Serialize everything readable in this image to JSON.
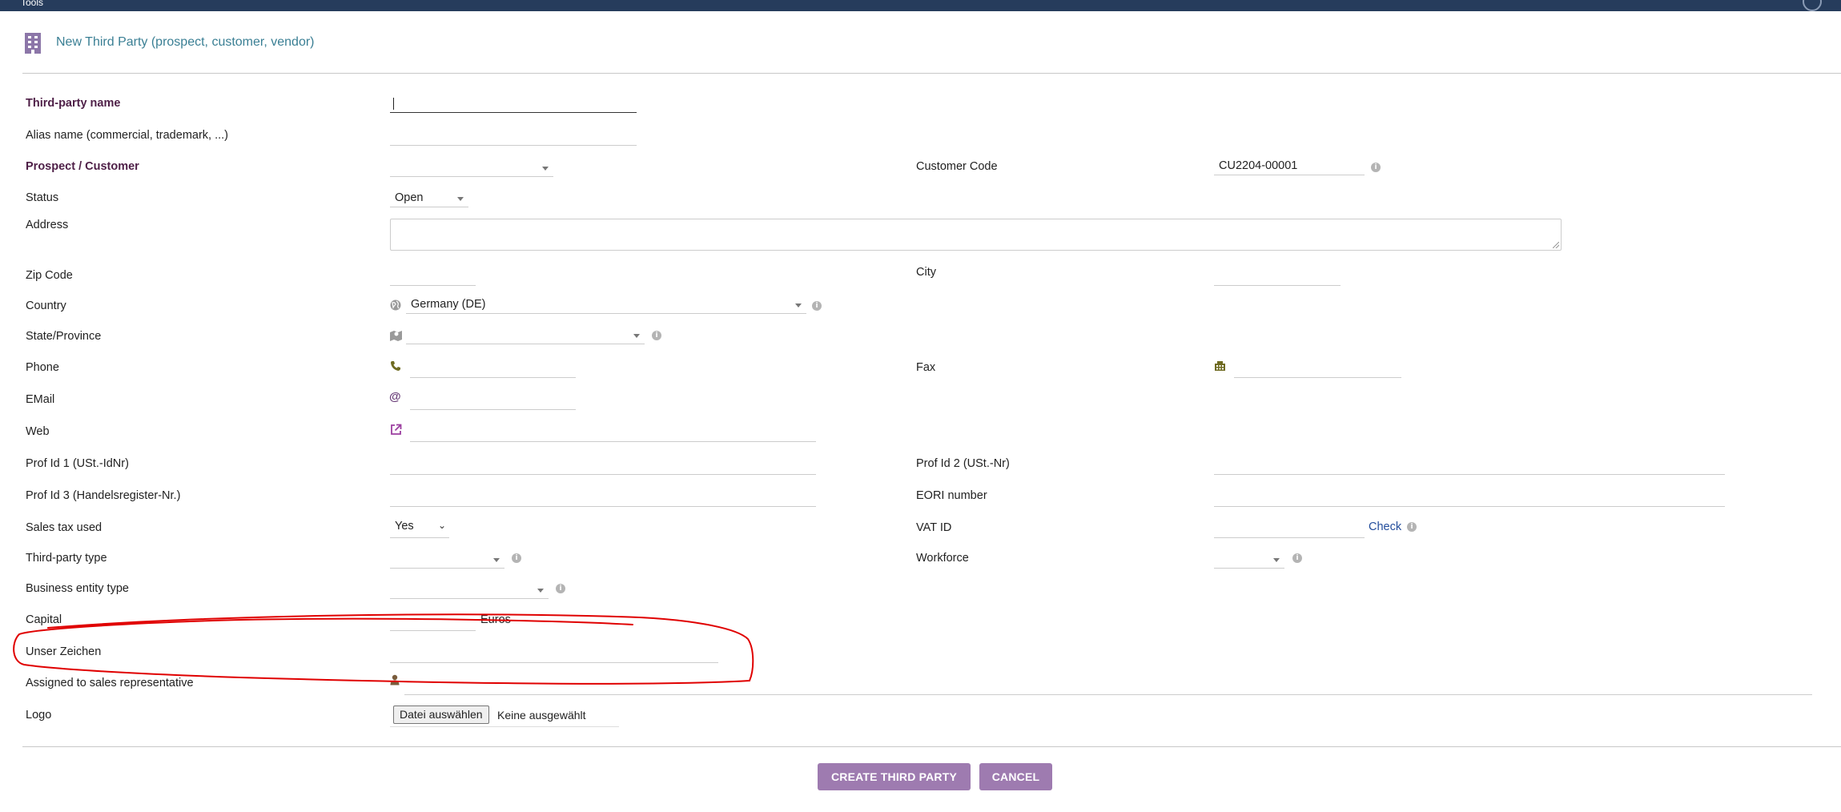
{
  "topbar": {
    "title": "Tools"
  },
  "header": {
    "title": "New Third Party (prospect, customer, vendor)",
    "icon": "building-icon",
    "icon_color": "#8c76a8"
  },
  "form": {
    "third_party_name": {
      "label": "Third-party name",
      "value": ""
    },
    "alias_name": {
      "label": "Alias name (commercial, trademark, ...)",
      "value": ""
    },
    "prospect_customer": {
      "label": "Prospect / Customer",
      "value": ""
    },
    "customer_code": {
      "label": "Customer Code",
      "value": "CU2204-00001"
    },
    "status": {
      "label": "Status",
      "value": "Open"
    },
    "address": {
      "label": "Address",
      "value": ""
    },
    "zip": {
      "label": "Zip Code",
      "value": ""
    },
    "city": {
      "label": "City",
      "value": ""
    },
    "country": {
      "label": "Country",
      "value": "Germany (DE)"
    },
    "state": {
      "label": "State/Province",
      "value": ""
    },
    "phone": {
      "label": "Phone",
      "value": ""
    },
    "fax": {
      "label": "Fax",
      "value": ""
    },
    "email": {
      "label": "EMail",
      "value": ""
    },
    "web": {
      "label": "Web",
      "value": ""
    },
    "prof_id_1": {
      "label": "Prof Id 1 (USt.-IdNr)",
      "value": ""
    },
    "prof_id_2": {
      "label": "Prof Id 2 (USt.-Nr)",
      "value": ""
    },
    "prof_id_3": {
      "label": "Prof Id 3 (Handelsregister-Nr.)",
      "value": ""
    },
    "eori": {
      "label": "EORI number",
      "value": ""
    },
    "sales_tax": {
      "label": "Sales tax used",
      "value": "Yes"
    },
    "vat_id": {
      "label": "VAT ID",
      "value": "",
      "check_link": "Check"
    },
    "third_party_type": {
      "label": "Third-party type",
      "value": ""
    },
    "workforce": {
      "label": "Workforce",
      "value": ""
    },
    "business_entity": {
      "label": "Business entity type",
      "value": ""
    },
    "capital": {
      "label": "Capital",
      "value": "",
      "currency": "Euros"
    },
    "unser_zeichen": {
      "label": "Unser Zeichen",
      "value": ""
    },
    "sales_rep": {
      "label": "Assigned to sales representative",
      "value": ""
    },
    "logo": {
      "label": "Logo",
      "button": "Datei auswählen",
      "status": "Keine ausgewählt"
    }
  },
  "actions": {
    "create": "CREATE THIRD PARTY",
    "cancel": "CANCEL"
  },
  "colors": {
    "required_label": "#4e1f47",
    "title": "#3a7f94",
    "button_bg": "#9e7bb0",
    "annotation": "#e00000",
    "phone_icon": "#6f6b22",
    "email_icon": "#6b3f7a",
    "link": "#234d9c"
  }
}
